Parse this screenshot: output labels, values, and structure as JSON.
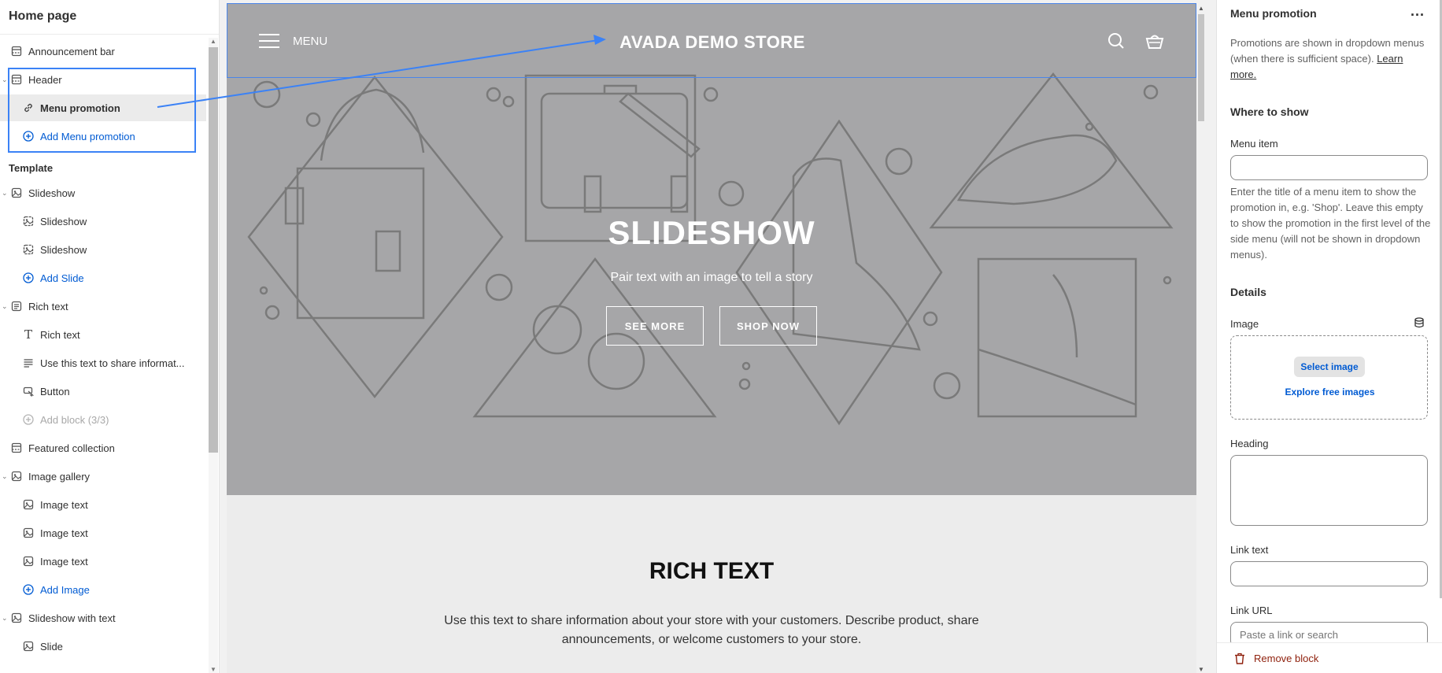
{
  "left_panel": {
    "title": "Home page",
    "items": [
      {
        "label": "Announcement bar",
        "icon": "section-icon"
      },
      {
        "label": "Header",
        "icon": "section-icon"
      },
      {
        "label": "Menu promotion",
        "icon": "link-icon"
      },
      {
        "label": "Add Menu promotion",
        "icon": "plus-circle-icon"
      },
      {
        "label": "Template"
      },
      {
        "label": "Slideshow",
        "icon": "slideshow-icon"
      },
      {
        "label": "Slideshow",
        "icon": "image-icon"
      },
      {
        "label": "Slideshow",
        "icon": "image-icon"
      },
      {
        "label": "Add Slide",
        "icon": "plus-circle-icon"
      },
      {
        "label": "Rich text",
        "icon": "text-section-icon"
      },
      {
        "label": "Rich text",
        "icon": "type-icon"
      },
      {
        "label": "Use this text to share informat...",
        "icon": "paragraph-icon"
      },
      {
        "label": "Button",
        "icon": "button-icon"
      },
      {
        "label": "Add block (3/3)",
        "icon": "plus-circle-icon"
      },
      {
        "label": "Featured collection",
        "icon": "section-icon"
      },
      {
        "label": "Image gallery",
        "icon": "slideshow-icon"
      },
      {
        "label": "Image text",
        "icon": "image-icon"
      },
      {
        "label": "Image text",
        "icon": "image-icon"
      },
      {
        "label": "Image text",
        "icon": "image-icon"
      },
      {
        "label": "Add Image",
        "icon": "plus-circle-icon"
      },
      {
        "label": "Slideshow with text",
        "icon": "slideshow-icon"
      },
      {
        "label": "Slide",
        "icon": "image-icon"
      }
    ]
  },
  "preview": {
    "menu_label": "MENU",
    "store_name": "AVADA DEMO STORE",
    "hero_title": "SLIDESHOW",
    "hero_subtitle": "Pair text with an image to tell a story",
    "btn_see_more": "SEE MORE",
    "btn_shop_now": "SHOP NOW",
    "rich_title": "RICH TEXT",
    "rich_text": "Use this text to share information about your store with your customers. Describe product, share announcements, or welcome customers to your store."
  },
  "right_panel": {
    "title": "Menu promotion",
    "more_icon": "...",
    "description": "Promotions are shown in dropdown menus (when there is sufficient space).",
    "learn_more": "Learn more.",
    "where_heading": "Where to show",
    "menu_item_label": "Menu item",
    "menu_item_value": "",
    "menu_item_help": "Enter the title of a menu item to show the promotion in, e.g. 'Shop'. Leave this empty to show the promotion in the first level of the side menu (will not be shown in dropdown menus).",
    "details_heading": "Details",
    "image_label": "Image",
    "select_image": "Select image",
    "explore_images": "Explore free images",
    "heading_label": "Heading",
    "link_text_label": "Link text",
    "link_url_label": "Link URL",
    "link_url_placeholder": "Paste a link or search",
    "remove_block": "Remove block"
  },
  "colors": {
    "accent": "#005bd3",
    "highlight": "#3b82f6",
    "hero_bg": "#a6a6a8",
    "danger": "#8e1f0b"
  }
}
